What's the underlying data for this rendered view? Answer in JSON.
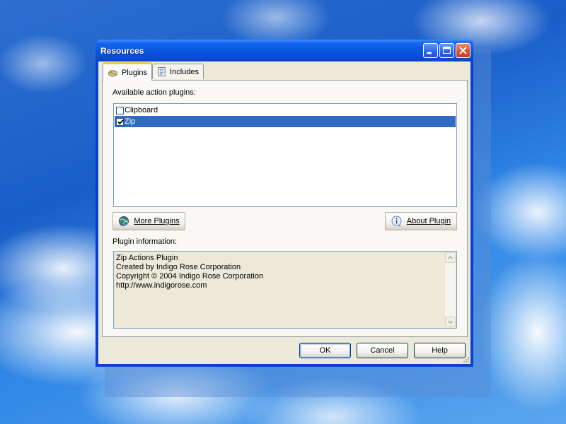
{
  "window": {
    "title": "Resources",
    "minimize_label": "Minimize",
    "maximize_label": "Maximize",
    "close_label": "Close"
  },
  "tabs": [
    {
      "label": "Plugins",
      "icon": "plugin-icon",
      "active": true
    },
    {
      "label": "Includes",
      "icon": "document-icon",
      "active": false
    }
  ],
  "plugins_tab": {
    "available_label": "Available action plugins:",
    "plugins": [
      {
        "name": "Clipboard",
        "checked": false,
        "selected": false
      },
      {
        "name": "Zip",
        "checked": true,
        "selected": true
      }
    ],
    "more_plugins_label": "More Plugins",
    "more_plugins_icon": "globe-icon",
    "about_plugin_label": "About Plugin",
    "about_plugin_icon": "info-icon",
    "info_label": "Plugin information:",
    "info_lines": [
      "Zip Actions Plugin",
      "Created by Indigo Rose Corporation",
      "Copyright © 2004 Indigo Rose Corporation",
      "http://www.indigorose.com"
    ]
  },
  "footer": {
    "ok_label": "OK",
    "cancel_label": "Cancel",
    "help_label": "Help"
  },
  "colors": {
    "title_bar": "#0a56e0",
    "selection": "#316ac5",
    "dialog_face": "#ece9d8",
    "tab_highlight": "#ffc83c"
  }
}
